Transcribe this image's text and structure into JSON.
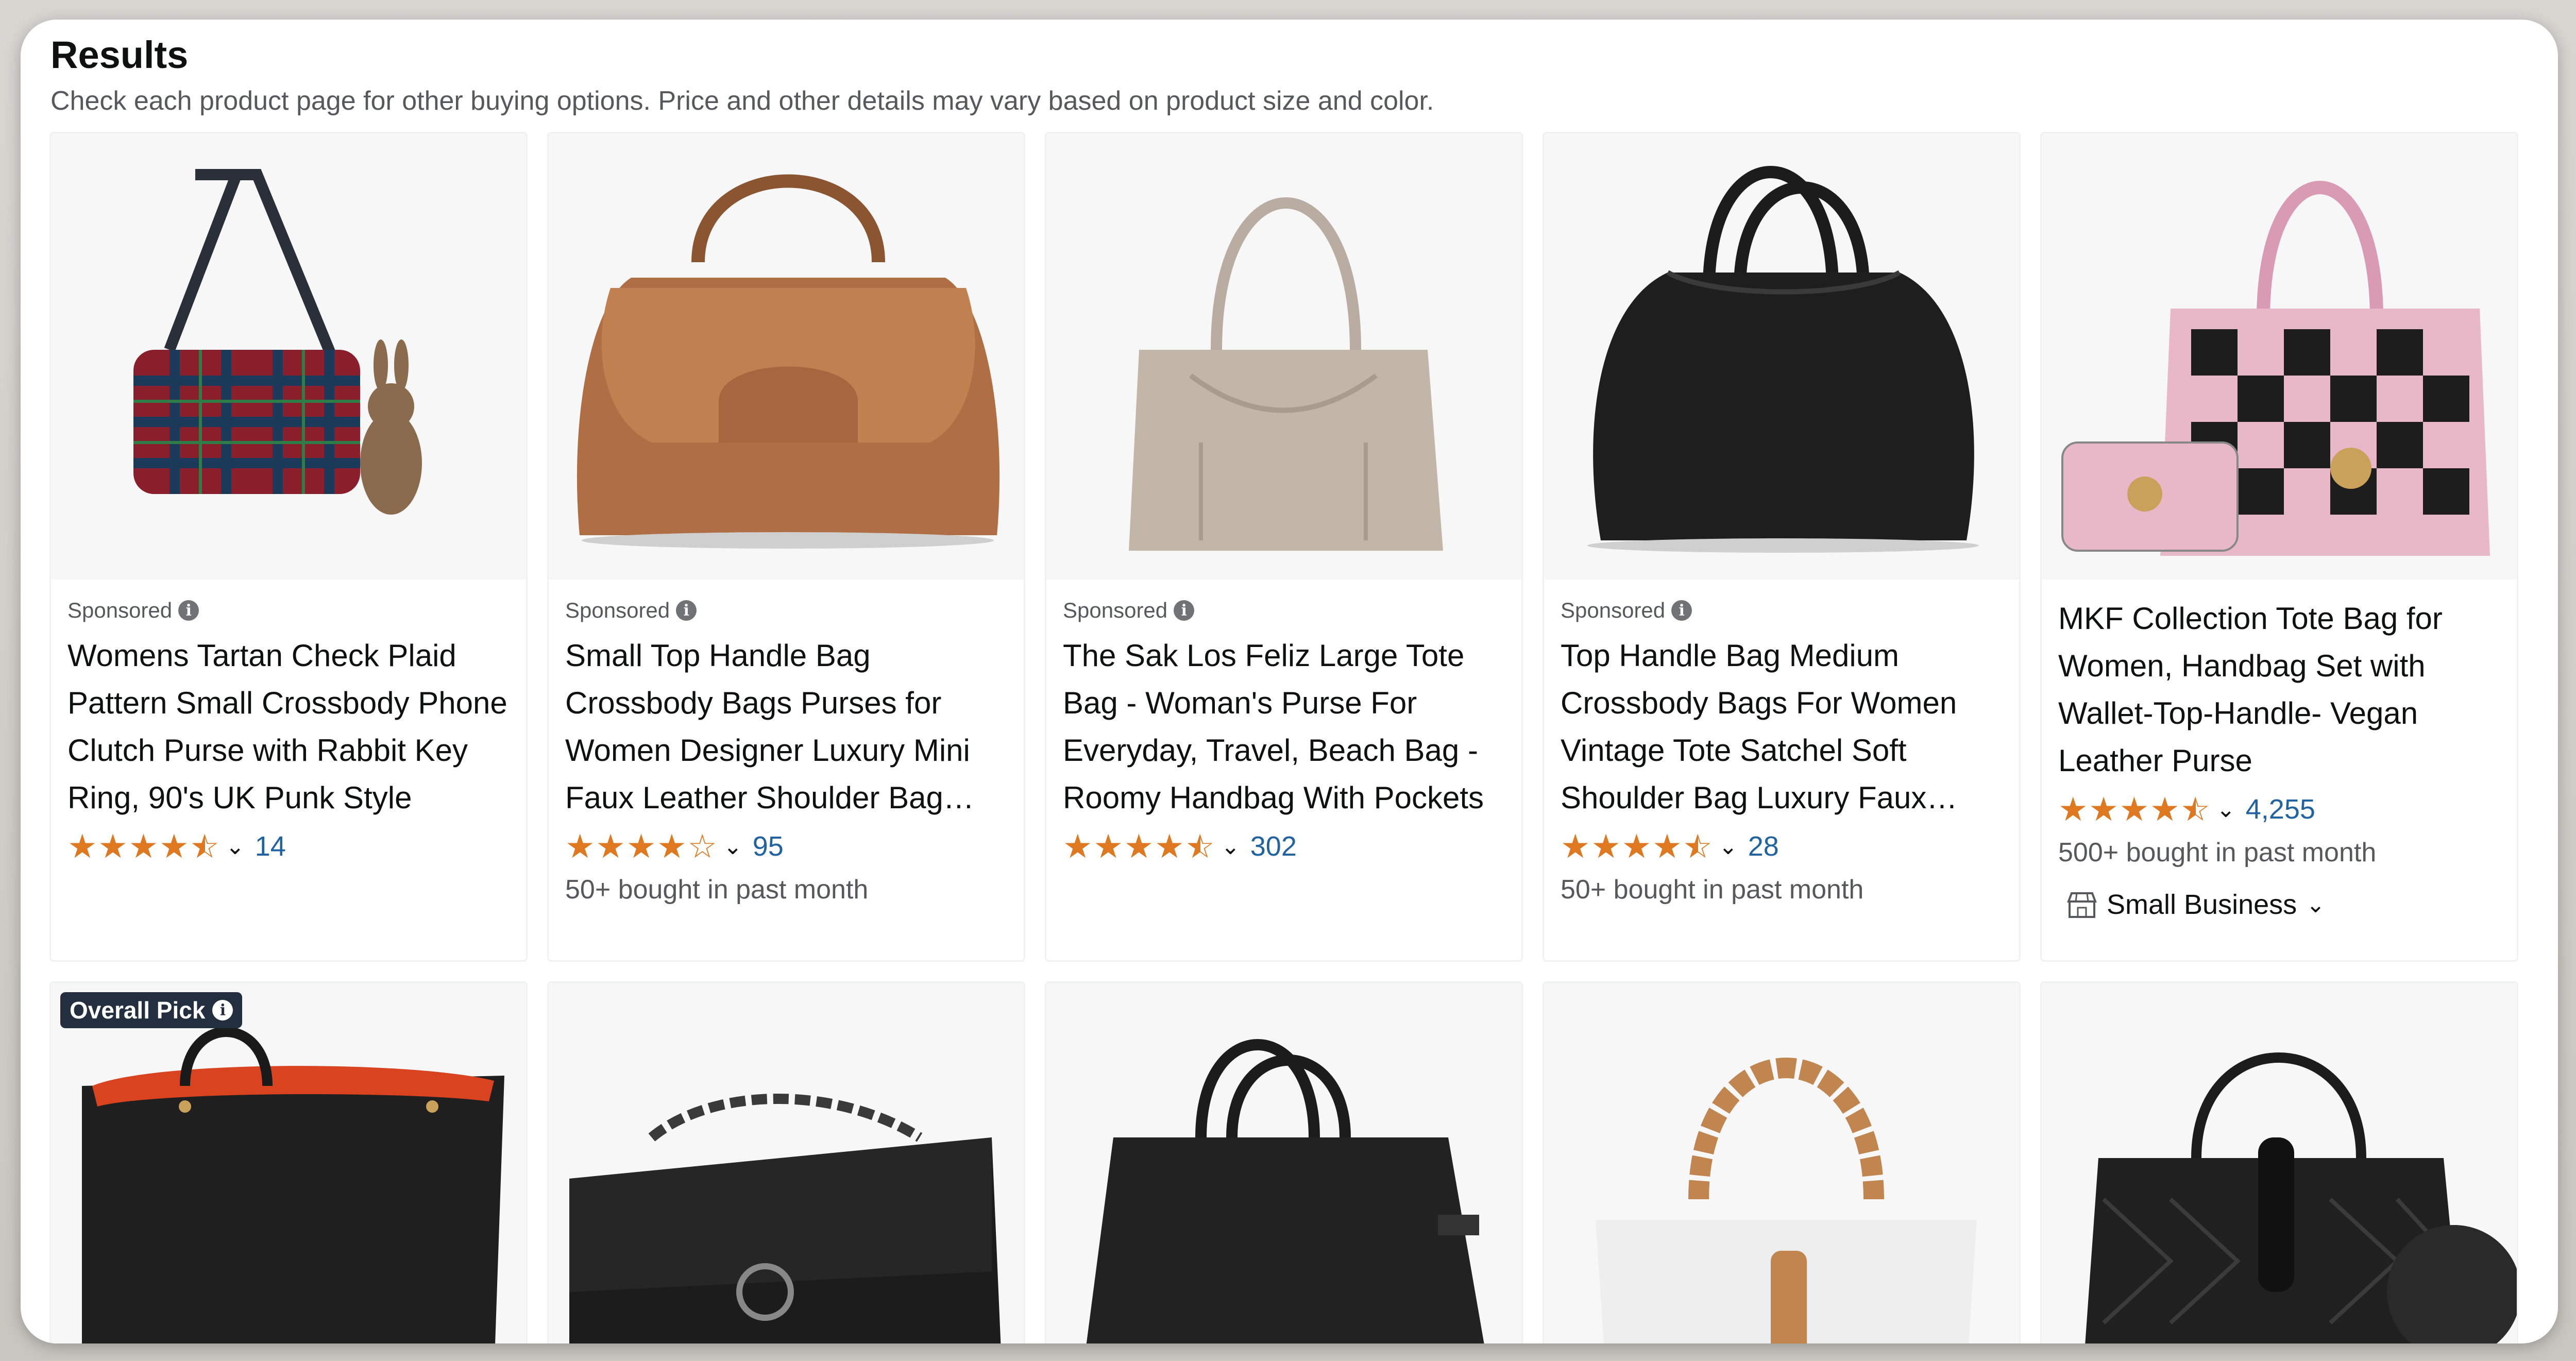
{
  "page": {
    "heading": "Results",
    "subheading": "Check each product page for other buying options. Price and other details may vary based on product size and color."
  },
  "products_row1": [
    {
      "sponsored": "Sponsored",
      "title": "Womens Tartan Check Plaid Pattern Small Crossbody Phone Clutch Purse with Rabbit Key Ring, 90's UK Punk Style",
      "rating": 4.5,
      "rating_count": "14",
      "bought": "",
      "image_icon": "plaid-crossbody-bag-icon"
    },
    {
      "sponsored": "Sponsored",
      "title": "Small Top Handle Bag Crossbody Bags Purses for Women Designer Luxury Mini Faux Leather Shoulder Bag Handbag",
      "rating": 4.0,
      "rating_count": "95",
      "bought": "50+ bought in past month",
      "image_icon": "brown-top-handle-bag-icon"
    },
    {
      "sponsored": "Sponsored",
      "title": "The Sak Los Feliz Large Tote Bag - Woman's Purse For Everyday, Travel, Beach Bag - Roomy Handbag With Pockets",
      "rating": 4.5,
      "rating_count": "302",
      "bought": "",
      "image_icon": "suede-tote-bag-icon"
    },
    {
      "sponsored": "Sponsored",
      "title": "Top Handle Bag Medium Crossbody Bags For Women Vintage Tote Satchel Soft Shoulder Bag Luxury Faux Leather",
      "rating": 4.5,
      "rating_count": "28",
      "bought": "50+ bought in past month",
      "image_icon": "black-satchel-bag-icon"
    },
    {
      "sponsored": "",
      "title": "MKF Collection Tote Bag for Women, Handbag Set with Wallet-Top-Handle- Vegan Leather Purse",
      "rating": 4.5,
      "rating_count": "4,255",
      "bought": "500+ bought in past month",
      "small_business": "Small Business",
      "image_icon": "pink-checkered-tote-icon"
    }
  ],
  "products_row2": [
    {
      "badge": "Overall Pick",
      "image_icon": "black-leather-tote-icon"
    },
    {
      "image_icon": "black-chain-shoulder-bag-icon"
    },
    {
      "image_icon": "black-structured-tote-icon"
    },
    {
      "image_icon": "white-braided-handle-bag-icon"
    },
    {
      "image_icon": "black-quilted-bag-icon"
    }
  ],
  "colors": {
    "star": "#de7921",
    "link": "#2162a1",
    "text_primary": "#0f1111",
    "text_secondary": "#565959",
    "badge_bg": "#232f3e"
  },
  "icons": {
    "info": "info-icon",
    "chevron": "chevron-down-icon",
    "store": "store-icon",
    "star": "star-icon"
  }
}
